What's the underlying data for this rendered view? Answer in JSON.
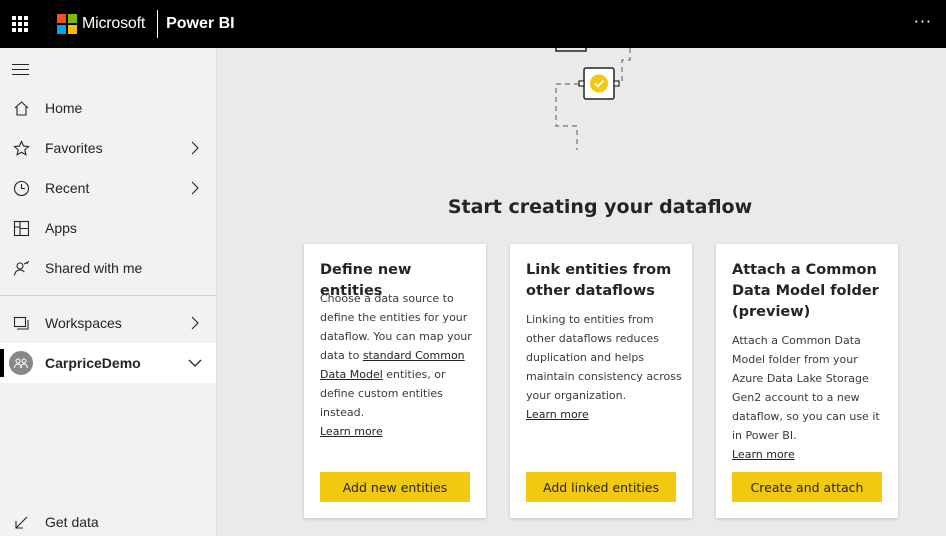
{
  "topbar": {
    "brand": "Microsoft",
    "product": "Power BI",
    "more_label": "···",
    "brand_colors": [
      "#f25022",
      "#7fba00",
      "#00a4ef",
      "#ffb900"
    ]
  },
  "sidebar": {
    "items": [
      {
        "label": "Home",
        "icon": "home-icon"
      },
      {
        "label": "Favorites",
        "icon": "star-icon"
      },
      {
        "label": "Recent",
        "icon": "clock-icon"
      },
      {
        "label": "Apps",
        "icon": "apps-icon"
      },
      {
        "label": "Shared with me",
        "icon": "shared-icon"
      },
      {
        "label": "Workspaces",
        "icon": "workspaces-icon"
      },
      {
        "label": "CarpriceDemo",
        "icon": "workspace-avatar"
      },
      {
        "label": "Get data",
        "icon": "get-data-icon"
      }
    ]
  },
  "main": {
    "heading": "Start creating your dataflow",
    "accent_color": "#f2c811",
    "cards": [
      {
        "title": "Define new entities",
        "body_1": "Choose a data source to define the entities for your dataflow. You can map your data to ",
        "link": "standard Common Data Model",
        "body_2": " entities, or define custom entities instead.",
        "learn_more": "Learn more",
        "button": "Add new entities"
      },
      {
        "title": "Link entities from other dataflows",
        "body": "Linking to entities from other dataflows reduces duplication and helps maintain consistency across your organization.",
        "learn_more": "Learn more",
        "button": "Add linked entities"
      },
      {
        "title": "Attach a Common Data Model folder (preview)",
        "body": "Attach a Common Data Model folder from your Azure Data Lake Storage Gen2 account to a new dataflow, so you can use it in Power BI.",
        "learn_more": "Learn more",
        "button": "Create and attach"
      }
    ]
  }
}
